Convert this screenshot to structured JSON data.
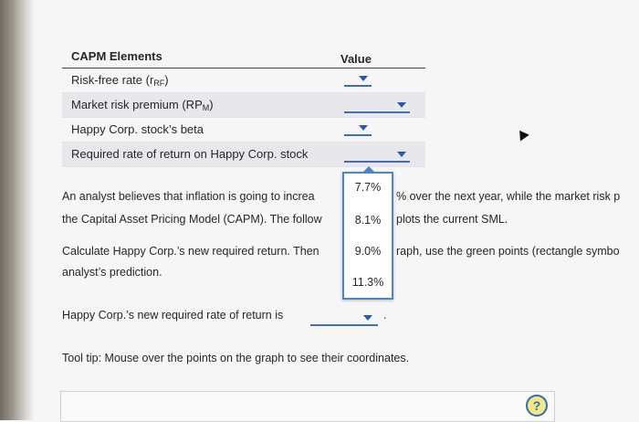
{
  "table": {
    "header_elements": "CAPM Elements",
    "header_value": "Value",
    "rows": [
      {
        "label_text": "Risk-free rate (r",
        "label_sub": "RF",
        "label_end": ")"
      },
      {
        "label_text": "Market risk premium (RP",
        "label_sub": "M",
        "label_end": ")"
      },
      {
        "label_text": "Happy Corp. stock’s beta",
        "label_sub": "",
        "label_end": ""
      },
      {
        "label_text": "Required rate of return on Happy Corp. stock",
        "label_sub": "",
        "label_end": ""
      }
    ]
  },
  "paragraph1": {
    "line1_a": "An analyst believes that inflation is going to increa",
    "line1_b": "% over the next year, while the market risk p",
    "line2_a": "the Capital Asset Pricing Model (CAPM). The follow",
    "line2_b": "plots the current SML."
  },
  "paragraph2": {
    "line1_a": "Calculate Happy Corp.’s new required return. Then",
    "line1_b": "raph, use the green points (rectangle symbo",
    "line2": "analyst’s prediction."
  },
  "dropdown_options": [
    "7.7%",
    "8.1%",
    "9.0%",
    "11.3%"
  ],
  "new_return_sentence": {
    "prefix": "Happy Corp.’s new required rate of return is",
    "suffix": "."
  },
  "tooltip_text": "Tool tip: Mouse over the points on the graph to see their coordinates.",
  "help_label": "?",
  "colors": {
    "accent": "#3f6fb6",
    "help_fill": "#f4e78a"
  },
  "icons": [
    "dropdown-arrow-icon",
    "help-icon",
    "cursor-icon"
  ]
}
